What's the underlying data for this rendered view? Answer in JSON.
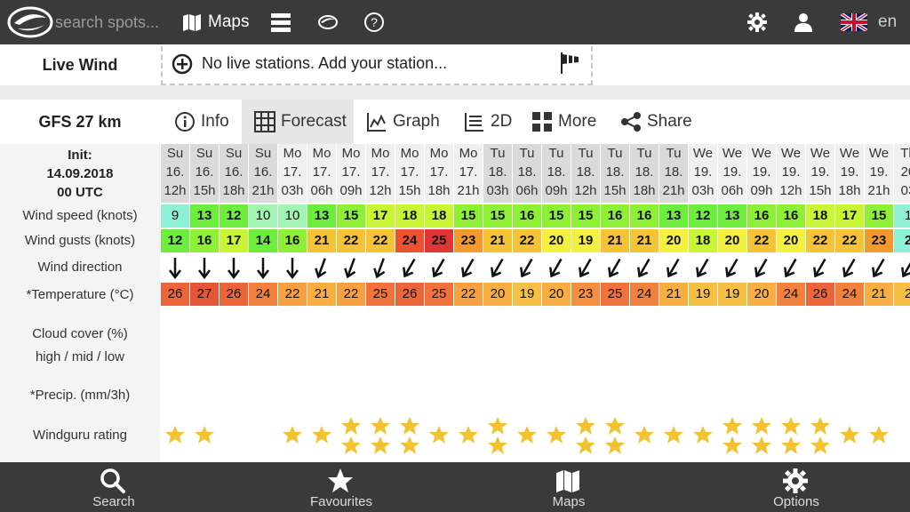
{
  "header": {
    "search_placeholder": "search spots...",
    "maps_label": "Maps",
    "language": "en"
  },
  "live_wind": {
    "label": "Live Wind",
    "message": "No live stations. Add your station..."
  },
  "model": {
    "label": "GFS 27 km"
  },
  "tabs": [
    {
      "label": "Info",
      "icon": "info-icon"
    },
    {
      "label": "Forecast",
      "icon": "grid-icon",
      "active": true
    },
    {
      "label": "Graph",
      "icon": "graph-icon"
    },
    {
      "label": "2D",
      "icon": "2d-icon"
    },
    {
      "label": "More",
      "icon": "more-icon"
    },
    {
      "label": "Share",
      "icon": "share-icon"
    }
  ],
  "init": {
    "title": "Init:",
    "date": "14.09.2018",
    "time": "00 UTC"
  },
  "row_labels": {
    "wind_speed": "Wind speed (knots)",
    "wind_gusts": "Wind gusts (knots)",
    "wind_direction": "Wind direction",
    "temperature": "*Temperature (°C)",
    "cloud_cover": "Cloud cover (%)",
    "cloud_levels": "high / mid / low",
    "precip": "*Precip. (mm/3h)",
    "rating": "Windguru rating"
  },
  "forecast": [
    {
      "day": "Su",
      "date": "16.",
      "hour": "12h",
      "ws": "9",
      "wg": "12",
      "tp": "26",
      "stars": 1
    },
    {
      "day": "Su",
      "date": "16.",
      "hour": "15h",
      "ws": "13",
      "wg": "16",
      "tp": "27",
      "stars": 1
    },
    {
      "day": "Su",
      "date": "16.",
      "hour": "18h",
      "ws": "12",
      "wg": "17",
      "tp": "26",
      "stars": 0
    },
    {
      "day": "Su",
      "date": "16.",
      "hour": "21h",
      "ws": "10",
      "wg": "14",
      "tp": "24",
      "stars": 0
    },
    {
      "day": "Mo",
      "date": "17.",
      "hour": "03h",
      "ws": "10",
      "wg": "16",
      "tp": "22",
      "stars": 1
    },
    {
      "day": "Mo",
      "date": "17.",
      "hour": "06h",
      "ws": "13",
      "wg": "21",
      "tp": "21",
      "stars": 1
    },
    {
      "day": "Mo",
      "date": "17.",
      "hour": "09h",
      "ws": "15",
      "wg": "22",
      "tp": "22",
      "stars": 2
    },
    {
      "day": "Mo",
      "date": "17.",
      "hour": "12h",
      "ws": "17",
      "wg": "22",
      "tp": "25",
      "stars": 2
    },
    {
      "day": "Mo",
      "date": "17.",
      "hour": "15h",
      "ws": "18",
      "wg": "24",
      "tp": "26",
      "stars": 2
    },
    {
      "day": "Mo",
      "date": "17.",
      "hour": "18h",
      "ws": "18",
      "wg": "25",
      "tp": "25",
      "stars": 1
    },
    {
      "day": "Mo",
      "date": "17.",
      "hour": "21h",
      "ws": "15",
      "wg": "23",
      "tp": "22",
      "stars": 1
    },
    {
      "day": "Tu",
      "date": "18.",
      "hour": "03h",
      "ws": "15",
      "wg": "21",
      "tp": "20",
      "stars": 2
    },
    {
      "day": "Tu",
      "date": "18.",
      "hour": "06h",
      "ws": "16",
      "wg": "22",
      "tp": "19",
      "stars": 1
    },
    {
      "day": "Tu",
      "date": "18.",
      "hour": "09h",
      "ws": "15",
      "wg": "20",
      "tp": "20",
      "stars": 1
    },
    {
      "day": "Tu",
      "date": "18.",
      "hour": "12h",
      "ws": "15",
      "wg": "19",
      "tp": "23",
      "stars": 2
    },
    {
      "day": "Tu",
      "date": "18.",
      "hour": "15h",
      "ws": "16",
      "wg": "21",
      "tp": "25",
      "stars": 2
    },
    {
      "day": "Tu",
      "date": "18.",
      "hour": "18h",
      "ws": "16",
      "wg": "21",
      "tp": "24",
      "stars": 1
    },
    {
      "day": "Tu",
      "date": "18.",
      "hour": "21h",
      "ws": "13",
      "wg": "20",
      "tp": "21",
      "stars": 1
    },
    {
      "day": "We",
      "date": "19.",
      "hour": "03h",
      "ws": "12",
      "wg": "18",
      "tp": "19",
      "stars": 1
    },
    {
      "day": "We",
      "date": "19.",
      "hour": "06h",
      "ws": "13",
      "wg": "20",
      "tp": "19",
      "stars": 2
    },
    {
      "day": "We",
      "date": "19.",
      "hour": "09h",
      "ws": "16",
      "wg": "22",
      "tp": "20",
      "stars": 2
    },
    {
      "day": "We",
      "date": "19.",
      "hour": "12h",
      "ws": "16",
      "wg": "20",
      "tp": "24",
      "stars": 2
    },
    {
      "day": "We",
      "date": "19.",
      "hour": "15h",
      "ws": "18",
      "wg": "22",
      "tp": "26",
      "stars": 2
    },
    {
      "day": "We",
      "date": "19.",
      "hour": "18h",
      "ws": "17",
      "wg": "22",
      "tp": "24",
      "stars": 1
    },
    {
      "day": "We",
      "date": "19.",
      "hour": "21h",
      "ws": "15",
      "wg": "23",
      "tp": "21",
      "stars": 1
    },
    {
      "day": "Th",
      "date": "20",
      "hour": "03",
      "ws": "1",
      "wg": "2",
      "tp": "2",
      "stars": 0
    }
  ],
  "bottom_nav": [
    {
      "label": "Search",
      "icon": "search-icon"
    },
    {
      "label": "Favourites",
      "icon": "star-icon"
    },
    {
      "label": "Maps",
      "icon": "map-icon"
    },
    {
      "label": "Options",
      "icon": "gear-icon"
    }
  ]
}
